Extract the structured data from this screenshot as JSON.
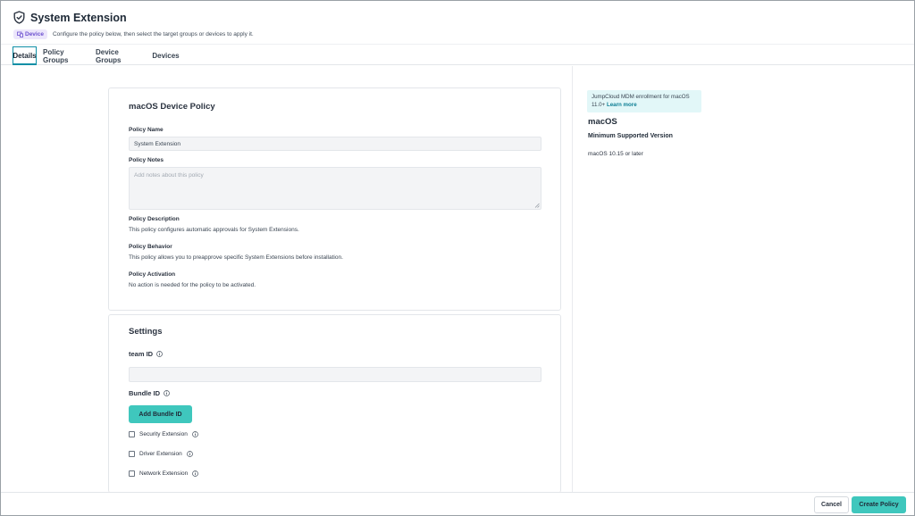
{
  "header": {
    "title": "System Extension",
    "badge": "Device",
    "subtitle": "Configure the policy below, then select the target groups or devices to apply it."
  },
  "tabs": [
    {
      "label": "Details",
      "active": true
    },
    {
      "label": "Policy Groups",
      "active": false
    },
    {
      "label": "Device Groups",
      "active": false
    },
    {
      "label": "Devices",
      "active": false
    }
  ],
  "policy_card": {
    "title": "macOS Device Policy",
    "policy_name_label": "Policy Name",
    "policy_name_value": "System Extension",
    "policy_notes_label": "Policy Notes",
    "policy_notes_placeholder": "Add notes about this policy",
    "description_label": "Policy Description",
    "description_text": "This policy configures automatic approvals for System Extensions.",
    "behavior_label": "Policy Behavior",
    "behavior_text": "This policy allows you to preapprove specific System Extensions before installation.",
    "activation_label": "Policy Activation",
    "activation_text": "No action is needed for the policy to be activated."
  },
  "settings_card": {
    "title": "Settings",
    "team_id_label": "team ID",
    "team_id_value": "",
    "bundle_id_label": "Bundle ID",
    "add_bundle_button": "Add Bundle ID",
    "checkboxes": [
      {
        "label": "Security Extension",
        "checked": false
      },
      {
        "label": "Driver Extension",
        "checked": false
      },
      {
        "label": "Network Extension",
        "checked": false
      }
    ]
  },
  "side": {
    "notice_text": "JumpCloud MDM enrollment for macOS 11.0+",
    "notice_link": "Learn more",
    "os": "macOS",
    "min_version_label": "Minimum Supported Version",
    "min_version_value": "macOS 10.15 or later"
  },
  "footer": {
    "cancel": "Cancel",
    "create": "Create Policy"
  },
  "colors": {
    "accent": "#3fc7bd",
    "tab_active_border": "#0f8fa6",
    "badge_bg": "#ece6fb",
    "badge_text": "#6b4fcf",
    "notice_bg": "#e2f7f8"
  },
  "icons": {
    "title": "shield-check-icon",
    "badge": "device-icon",
    "info": "info-icon"
  }
}
